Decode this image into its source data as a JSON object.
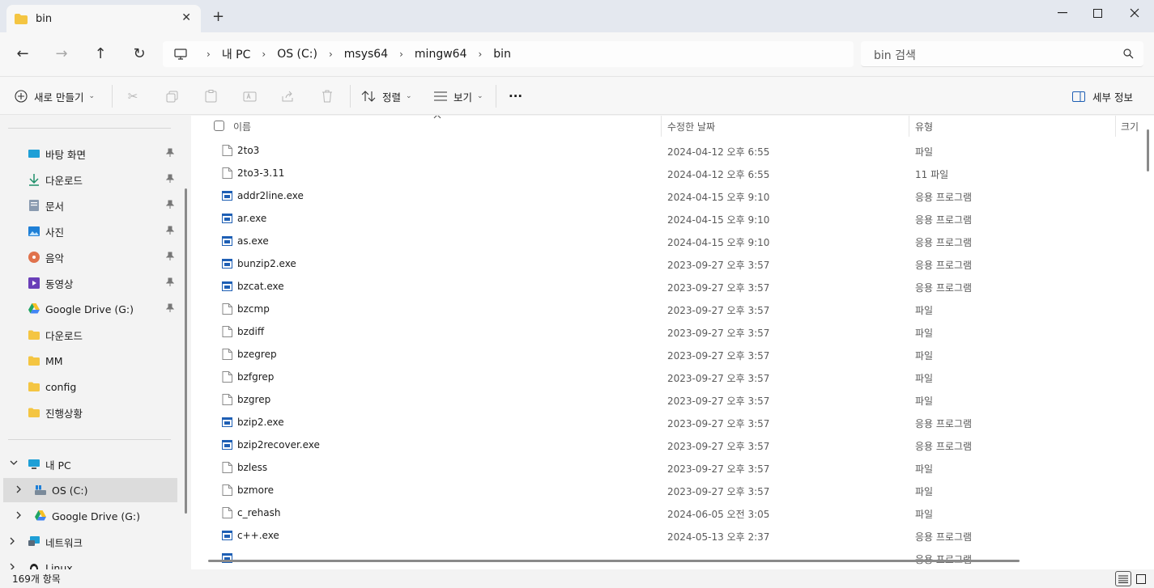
{
  "window": {
    "tab_title": "bin",
    "tab_close": "✕",
    "new_tab": "+",
    "minimize": "—",
    "maximize": "☐",
    "close": "✕"
  },
  "nav": {
    "back": "←",
    "forward": "→",
    "up": "↑",
    "refresh": "↻"
  },
  "breadcrumb": [
    "내 PC",
    "OS (C:)",
    "msys64",
    "mingw64",
    "bin"
  ],
  "breadcrumb_sep": "›",
  "search": {
    "placeholder": "bin 검색"
  },
  "toolbar": {
    "new_label": "새로 만들기",
    "sort_label": "정렬",
    "view_label": "보기",
    "more": "···",
    "details_label": "세부 정보",
    "chevron": "⌄"
  },
  "sidebar": {
    "quick": [
      {
        "label": "바탕 화면",
        "icon": "desktop-icon",
        "pinned": true
      },
      {
        "label": "다운로드",
        "icon": "download-icon",
        "pinned": true
      },
      {
        "label": "문서",
        "icon": "document-icon",
        "pinned": true
      },
      {
        "label": "사진",
        "icon": "pictures-icon",
        "pinned": true
      },
      {
        "label": "음악",
        "icon": "music-icon",
        "pinned": true
      },
      {
        "label": "동영상",
        "icon": "video-icon",
        "pinned": true
      },
      {
        "label": "Google Drive (G:)",
        "icon": "google-drive-icon",
        "pinned": true
      },
      {
        "label": "다운로드",
        "icon": "folder-icon",
        "pinned": false
      },
      {
        "label": "MM",
        "icon": "folder-icon",
        "pinned": false
      },
      {
        "label": "config",
        "icon": "folder-icon",
        "pinned": false
      },
      {
        "label": "진행상황",
        "icon": "folder-icon",
        "pinned": false
      }
    ],
    "pc_label": "내 PC",
    "drives": [
      {
        "label": "OS (C:)",
        "icon": "os-drive-icon",
        "selected": true
      },
      {
        "label": "Google Drive (G:)",
        "icon": "google-drive-icon",
        "selected": false
      }
    ],
    "network_label": "네트워크",
    "linux_label": "Linux",
    "pin_glyph": "📌"
  },
  "columns": {
    "name": "이름",
    "date": "수정한 날짜",
    "type": "유형",
    "size": "크기"
  },
  "files": [
    {
      "name": "2to3",
      "date": "2024-04-12 오후 6:55",
      "type": "파일",
      "kind": "file"
    },
    {
      "name": "2to3-3.11",
      "date": "2024-04-12 오후 6:55",
      "type": "11 파일",
      "kind": "file"
    },
    {
      "name": "addr2line.exe",
      "date": "2024-04-15 오후 9:10",
      "type": "응용 프로그램",
      "kind": "exe"
    },
    {
      "name": "ar.exe",
      "date": "2024-04-15 오후 9:10",
      "type": "응용 프로그램",
      "kind": "exe"
    },
    {
      "name": "as.exe",
      "date": "2024-04-15 오후 9:10",
      "type": "응용 프로그램",
      "kind": "exe"
    },
    {
      "name": "bunzip2.exe",
      "date": "2023-09-27 오후 3:57",
      "type": "응용 프로그램",
      "kind": "exe"
    },
    {
      "name": "bzcat.exe",
      "date": "2023-09-27 오후 3:57",
      "type": "응용 프로그램",
      "kind": "exe"
    },
    {
      "name": "bzcmp",
      "date": "2023-09-27 오후 3:57",
      "type": "파일",
      "kind": "file"
    },
    {
      "name": "bzdiff",
      "date": "2023-09-27 오후 3:57",
      "type": "파일",
      "kind": "file"
    },
    {
      "name": "bzegrep",
      "date": "2023-09-27 오후 3:57",
      "type": "파일",
      "kind": "file"
    },
    {
      "name": "bzfgrep",
      "date": "2023-09-27 오후 3:57",
      "type": "파일",
      "kind": "file"
    },
    {
      "name": "bzgrep",
      "date": "2023-09-27 오후 3:57",
      "type": "파일",
      "kind": "file"
    },
    {
      "name": "bzip2.exe",
      "date": "2023-09-27 오후 3:57",
      "type": "응용 프로그램",
      "kind": "exe"
    },
    {
      "name": "bzip2recover.exe",
      "date": "2023-09-27 오후 3:57",
      "type": "응용 프로그램",
      "kind": "exe"
    },
    {
      "name": "bzless",
      "date": "2023-09-27 오후 3:57",
      "type": "파일",
      "kind": "file"
    },
    {
      "name": "bzmore",
      "date": "2023-09-27 오후 3:57",
      "type": "파일",
      "kind": "file"
    },
    {
      "name": "c_rehash",
      "date": "2024-06-05 오전 3:05",
      "type": "파일",
      "kind": "file"
    },
    {
      "name": "c++.exe",
      "date": "2024-05-13 오후 2:37",
      "type": "응용 프로그램",
      "kind": "exe"
    },
    {
      "name": "",
      "date": "",
      "type": "응용 프로그램",
      "kind": "exe"
    }
  ],
  "status": {
    "item_count": "169개 항목"
  },
  "colors": {
    "folder": "#f4c542",
    "exe_blue": "#1e5fb4",
    "selection": "#dcdcdc",
    "titlebar": "#e4e8ef"
  }
}
